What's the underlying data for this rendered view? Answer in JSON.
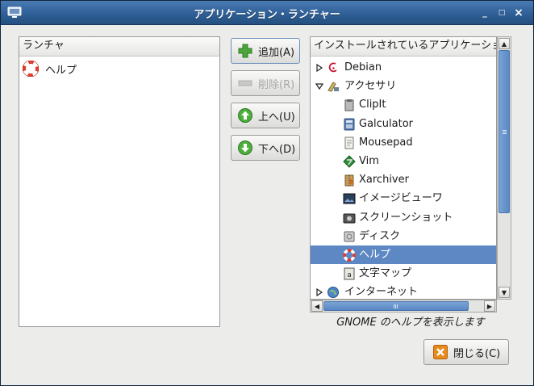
{
  "window": {
    "title": "アプリケーション・ランチャー",
    "minimize": "_",
    "maximize": "□",
    "close": "×"
  },
  "launcher": {
    "header": "ランチャ",
    "items": [
      {
        "label": "ヘルプ",
        "icon": "lifebuoy-icon"
      }
    ]
  },
  "actions": {
    "add": "追加(A)",
    "remove": "削除(R)",
    "up": "上へ(U)",
    "down": "下へ(D)"
  },
  "apps": {
    "header": "インストールされているアプリケーション",
    "rows": [
      {
        "label": "Debian",
        "icon": "debian-swirl-icon",
        "level": 0,
        "expander": "collapsed"
      },
      {
        "label": "アクセサリ",
        "icon": "accessories-icon",
        "level": 0,
        "expander": "expanded"
      },
      {
        "label": "ClipIt",
        "icon": "clipboard-icon",
        "level": 1
      },
      {
        "label": "Galculator",
        "icon": "calculator-icon",
        "level": 1
      },
      {
        "label": "Mousepad",
        "icon": "text-editor-icon",
        "level": 1
      },
      {
        "label": "Vim",
        "icon": "vim-icon",
        "level": 1
      },
      {
        "label": "Xarchiver",
        "icon": "archive-icon",
        "level": 1
      },
      {
        "label": "イメージビューワ",
        "icon": "image-viewer-icon",
        "level": 1
      },
      {
        "label": "スクリーンショット",
        "icon": "screenshot-icon",
        "level": 1
      },
      {
        "label": "ディスク",
        "icon": "disk-icon",
        "level": 1
      },
      {
        "label": "ヘルプ",
        "icon": "lifebuoy-icon",
        "level": 1,
        "selected": true
      },
      {
        "label": "文字マップ",
        "icon": "character-map-icon",
        "level": 1
      },
      {
        "label": "インターネット",
        "icon": "globe-icon",
        "level": 0,
        "expander": "collapsed"
      }
    ],
    "description": "GNOME のヘルプを表示します"
  },
  "footer": {
    "close": "閉じる(C)"
  },
  "colors": {
    "titlebar": "#2f5f96",
    "selection": "#5d88c4",
    "add_icon": "#4aa53a",
    "arrow_icon": "#4caf3c",
    "close_icon": "#e8891c"
  }
}
